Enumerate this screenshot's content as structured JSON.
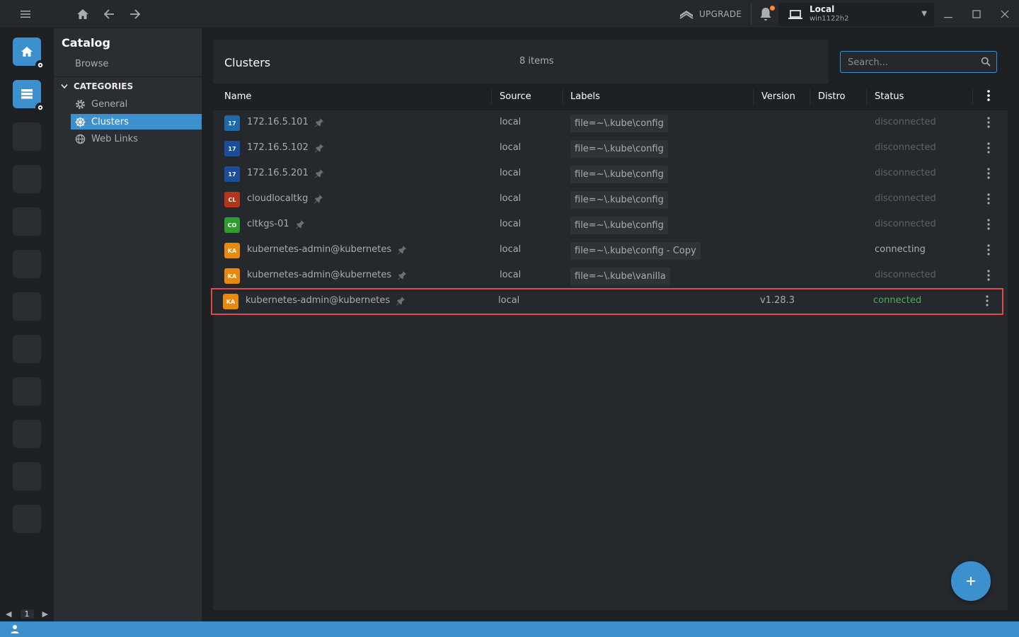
{
  "titlebar": {
    "upgrade_label": "UPGRADE",
    "cluster_title": "Local",
    "cluster_subtitle": "win1122h2"
  },
  "sidebar": {
    "title": "Catalog",
    "browse": "Browse",
    "categories_label": "CATEGORIES",
    "items": [
      {
        "label": "General",
        "icon": "gear-icon"
      },
      {
        "label": "Clusters",
        "icon": "helm-icon",
        "active": true
      },
      {
        "label": "Web Links",
        "icon": "globe-icon"
      }
    ]
  },
  "hotbar": {
    "page": "1"
  },
  "panel": {
    "title": "Clusters",
    "count": "8 items",
    "search_placeholder": "Search...",
    "columns": [
      "Name",
      "Source",
      "Labels",
      "Version",
      "Distro",
      "Status"
    ]
  },
  "rows": [
    {
      "badge": "17",
      "badge_color": "#1e6aa8",
      "name": "172.16.5.101",
      "source": "local",
      "label": "file=~\\.kube\\config",
      "version": "",
      "distro": "",
      "status": "disconnected"
    },
    {
      "badge": "17",
      "badge_color": "#1a4e9c",
      "name": "172.16.5.102",
      "source": "local",
      "label": "file=~\\.kube\\config",
      "version": "",
      "distro": "",
      "status": "disconnected"
    },
    {
      "badge": "17",
      "badge_color": "#1a4e9c",
      "name": "172.16.5.201",
      "source": "local",
      "label": "file=~\\.kube\\config",
      "version": "",
      "distro": "",
      "status": "disconnected"
    },
    {
      "badge": "CL",
      "badge_color": "#b5351c",
      "name": "cloudlocaltkg",
      "source": "local",
      "label": "file=~\\.kube\\config",
      "version": "",
      "distro": "",
      "status": "disconnected"
    },
    {
      "badge": "CO",
      "badge_color": "#2e9d2e",
      "name": "cltkgs-01",
      "source": "local",
      "label": "file=~\\.kube\\config",
      "version": "",
      "distro": "",
      "status": "disconnected"
    },
    {
      "badge": "KA",
      "badge_color": "#e8890c",
      "name": "kubernetes-admin@kubernetes",
      "source": "local",
      "label": "file=~\\.kube\\config - Copy",
      "version": "",
      "distro": "",
      "status": "connecting"
    },
    {
      "badge": "KA",
      "badge_color": "#e8890c",
      "name": "kubernetes-admin@kubernetes",
      "source": "local",
      "label": "file=~\\.kube\\vanilla",
      "version": "",
      "distro": "",
      "status": "disconnected"
    },
    {
      "badge": "KA",
      "badge_color": "#e8890c",
      "name": "kubernetes-admin@kubernetes",
      "source": "local",
      "label": "",
      "version": "v1.28.3",
      "distro": "",
      "status": "connected",
      "highlight": true
    }
  ],
  "fab_label": "+"
}
